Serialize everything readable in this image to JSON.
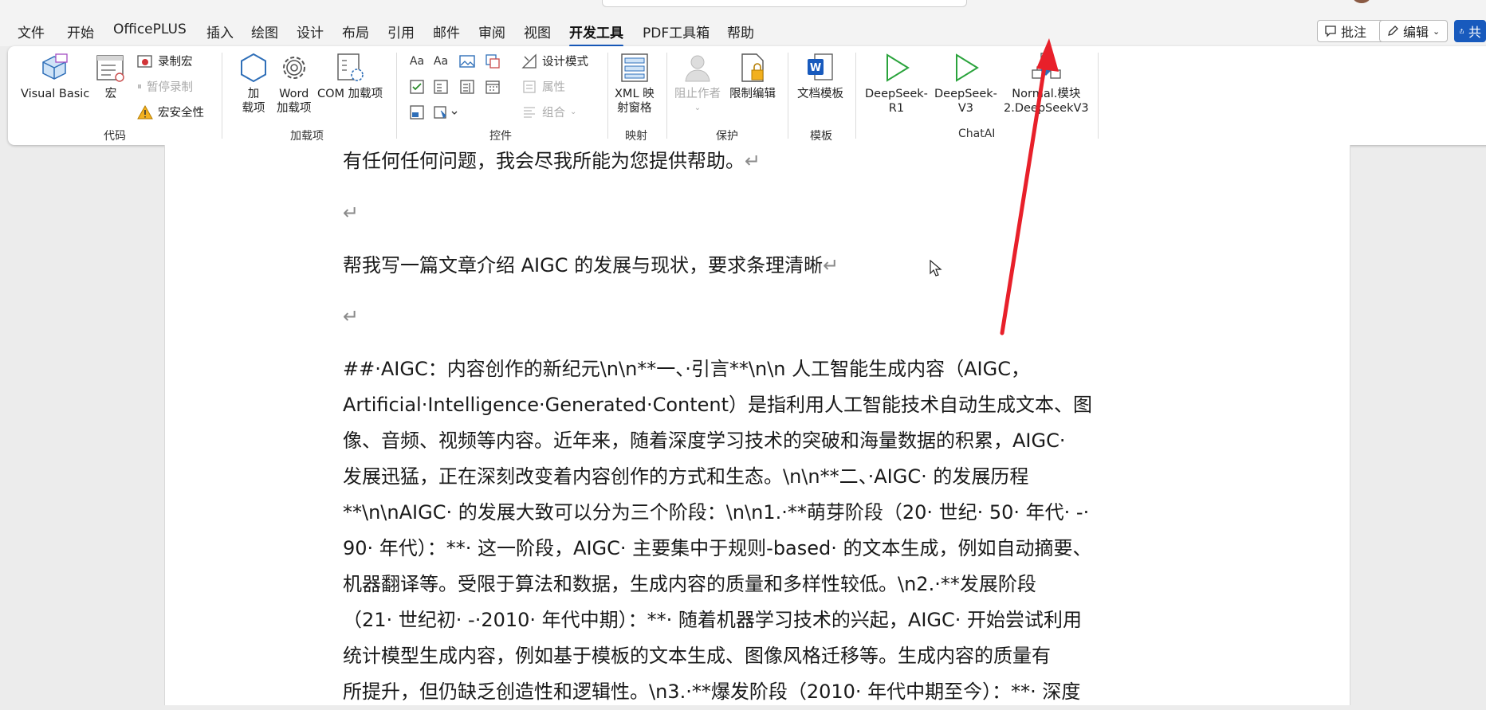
{
  "menu": {
    "tabs": [
      "文件",
      "开始",
      "OfficePLUS",
      "插入",
      "绘图",
      "设计",
      "布局",
      "引用",
      "邮件",
      "审阅",
      "视图",
      "开发工具",
      "PDF工具箱",
      "帮助"
    ],
    "active_tab": "开发工具",
    "comment_label": "批注",
    "edit_label": "编辑",
    "share_label": "共"
  },
  "ribbon": {
    "code": {
      "group": "代码",
      "visual_basic": "Visual Basic",
      "macro": "宏",
      "record_macro": "录制宏",
      "pause_record": "暂停录制",
      "macro_security": "宏安全性"
    },
    "addins": {
      "group": "加载项",
      "addin_l1": "加",
      "addin_l2": "载项",
      "word_l1": "Word",
      "word_l2": "加载项",
      "com": "COM 加载项"
    },
    "controls": {
      "group": "控件",
      "design_mode": "设计模式",
      "properties": "属性",
      "group_btn": "组合"
    },
    "mapping": {
      "group": "映射",
      "xml_l1": "XML 映",
      "xml_l2": "射窗格"
    },
    "protect": {
      "group": "保护",
      "block_authors": "阻止作者",
      "restrict_editing": "限制编辑"
    },
    "templates": {
      "group": "模板",
      "doc_template": "文档模板"
    },
    "chatai": {
      "group": "ChatAI",
      "r1_l1": "DeepSeek-",
      "r1_l2": "R1",
      "v3_l1": "DeepSeek-",
      "v3_l2": "V3",
      "module_l1": "Normal.模块",
      "module_l2": "2.DeepSeekV3"
    }
  },
  "document": {
    "p1": "有任何任何问题，我会尽我所能为您提供帮助。",
    "p2": "",
    "p3": "帮我写一篇文章介绍 AIGC 的发展与现状，要求条理清晰",
    "p4": "",
    "p5_lines": [
      "##·AIGC：内容创作的新纪元\\n\\n**一、·引言**\\n\\n 人工智能生成内容（AIGC，",
      "Artificial·Intelligence·Generated·Content）是指利用人工智能技术自动生成文本、图",
      "像、音频、视频等内容。近年来，随着深度学习技术的突破和海量数据的积累，AIGC·",
      "发展迅猛，正在深刻改变着内容创作的方式和生态。\\n\\n**二、·AIGC· 的发展历程",
      "**\\n\\nAIGC· 的发展大致可以分为三个阶段：\\n\\n1.·**萌芽阶段（20· 世纪· 50· 年代· -·",
      "90· 年代）：**· 这一阶段，AIGC· 主要集中于规则-based· 的文本生成，例如自动摘要、",
      "机器翻译等。受限于算法和数据，生成内容的质量和多样性较低。\\n2.·**发展阶段",
      "（21· 世纪初· -·2010· 年代中期）：**· 随着机器学习技术的兴起，AIGC· 开始尝试利用",
      "统计模型生成内容，例如基于模板的文本生成、图像风格迁移等。生成内容的质量有",
      "所提升，但仍缺乏创造性和逻辑性。\\n3.·**爆发阶段（2010· 年代中期至今）：**· 深度"
    ]
  },
  "colors": {
    "accent": "#185abd",
    "arrow": "#e8202a"
  }
}
